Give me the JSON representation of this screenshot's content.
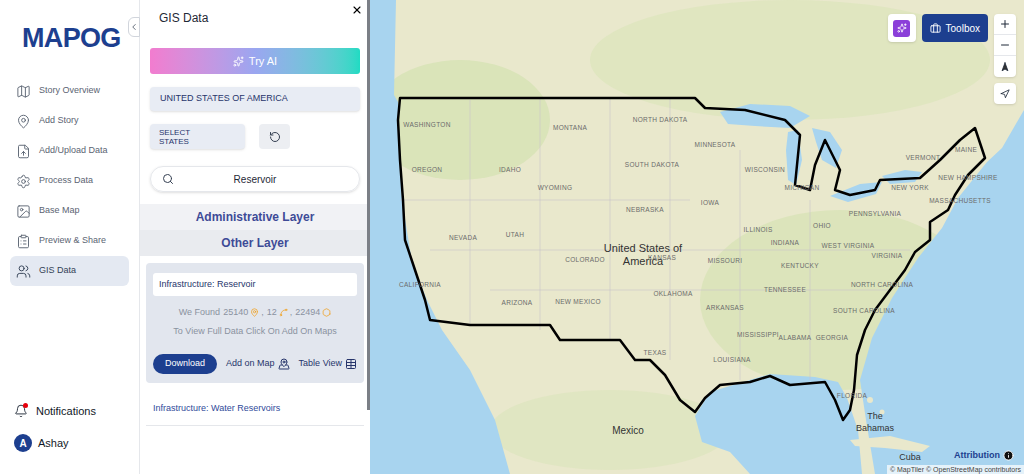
{
  "app": {
    "logo": "MAPOG"
  },
  "nav": {
    "items": [
      {
        "label": "Story Overview",
        "selected": false
      },
      {
        "label": "Add Story",
        "selected": false
      },
      {
        "label": "Add/Upload Data",
        "selected": false
      },
      {
        "label": "Process Data",
        "selected": false
      },
      {
        "label": "Base Map",
        "selected": false
      },
      {
        "label": "Preview & Share",
        "selected": false
      },
      {
        "label": "GIS Data",
        "selected": true
      }
    ]
  },
  "user_area": {
    "notifications": {
      "label": "Notifications",
      "unread": true
    },
    "user": {
      "initial": "A",
      "name": "Ashay"
    }
  },
  "panel": {
    "title": "GIS Data",
    "try_ai": "Try AI",
    "country": "UNITED STATES OF AMERICA",
    "select_states": "SELECT STATES",
    "search": {
      "value": "Reservoir"
    },
    "sections": [
      {
        "label": "Administrative Layer"
      },
      {
        "label": "Other Layer"
      }
    ],
    "results": [
      {
        "title": "Infrastructure: Reservoir",
        "expanded": true,
        "found_label": "We Found",
        "separator": ",",
        "counts": [
          {
            "value": "25140",
            "kind": "point"
          },
          {
            "value": "12",
            "kind": "line"
          },
          {
            "value": "22494",
            "kind": "polygon"
          }
        ],
        "hint": "To View Full Data Click On Add On Maps",
        "actions": [
          {
            "label": "Download",
            "kind": "primary"
          },
          {
            "label": "Add on Map",
            "kind": "link"
          },
          {
            "label": "Table View",
            "kind": "link"
          }
        ]
      },
      {
        "title": "Infrastructure: Water Reservoirs",
        "expanded": false
      }
    ]
  },
  "map": {
    "country_label": "United States of America",
    "state_labels": [
      "WASHINGTON",
      "OREGON",
      "CALIFORNIA",
      "NEVADA",
      "IDAHO",
      "MONTANA",
      "WYOMING",
      "UTAH",
      "ARIZONA",
      "COLORADO",
      "NEW MEXICO",
      "NORTH DAKOTA",
      "SOUTH DAKOTA",
      "NEBRASKA",
      "KANSAS",
      "OKLAHOMA",
      "TEXAS",
      "MINNESOTA",
      "IOWA",
      "MISSOURI",
      "ARKANSAS",
      "LOUISIANA",
      "WISCONSIN",
      "ILLINOIS",
      "MICHIGAN",
      "INDIANA",
      "OHIO",
      "KENTUCKY",
      "TENNESSEE",
      "MISSISSIPPI",
      "ALABAMA",
      "GEORGIA",
      "FLORIDA",
      "SOUTH CAROLINA",
      "NORTH CAROLINA",
      "VIRGINIA",
      "WEST VIRGINIA",
      "PENNSYLVANIA",
      "NEW YORK",
      "VERMONT",
      "MAINE",
      "NEW HAMPSHIRE",
      "MASSACHUSETTS"
    ],
    "place_labels": [
      "Mexico",
      "The Bahamas",
      "Cuba"
    ],
    "toolbox": "Toolbox",
    "attribution": "Attribution",
    "copyright": "© MapTiler © OpenStreetMap contributors"
  }
}
